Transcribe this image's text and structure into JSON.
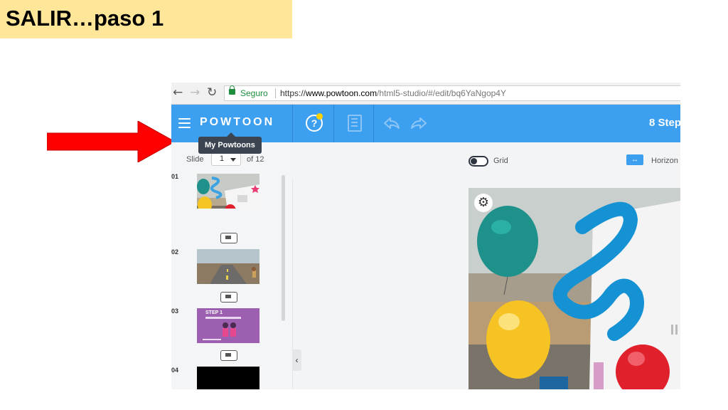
{
  "slide_title": "SALIR…paso 1",
  "browser": {
    "secure_label": "Seguro",
    "url_scheme": "https://",
    "url_host": "www.powtoon.com",
    "url_path": "/html5-studio/#/edit/bq6YaNgop4Y"
  },
  "app": {
    "logo": "POWTOON",
    "steps_label": "8 Step",
    "tooltip": "My Powtoons"
  },
  "left_panel": {
    "slide_label": "Slide",
    "slide_value": "1",
    "of_label": "of 12",
    "slides": [
      {
        "num": "01"
      },
      {
        "num": "02"
      },
      {
        "num": "03",
        "caption": "STEP 1"
      },
      {
        "num": "04"
      }
    ]
  },
  "toolbar": {
    "grid_label": "Grid",
    "horizontal_label": "Horizon"
  },
  "colors": {
    "title_bg": "#ffe699",
    "header_blue": "#3d9ff0",
    "arrow_red": "#ff0000",
    "notif_yellow": "#ffd200"
  },
  "icons": [
    "arrow-left-icon",
    "arrow-right-icon",
    "reload-icon",
    "lock-icon",
    "hamburger-menu-icon",
    "help-icon",
    "notes-icon",
    "undo-icon",
    "redo-icon",
    "chevron-down-icon",
    "transition-icon",
    "collapse-chevron-icon",
    "toggle-icon",
    "horizontal-align-icon",
    "gear-icon"
  ]
}
